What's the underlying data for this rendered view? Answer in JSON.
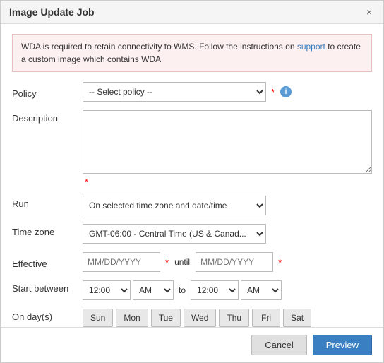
{
  "dialog": {
    "title": "Image Update Job",
    "close_label": "×"
  },
  "alert": {
    "message_part1": "WDA is required to retain connectivity to WMS. Follow the instructions on ",
    "link_text": "support",
    "message_part2": " to create a custom image which contains WDA"
  },
  "form": {
    "policy_label": "Policy",
    "policy_placeholder": "-- Select policy --",
    "description_label": "Description",
    "run_label": "Run",
    "run_placeholder": "On selected time zone and date/time",
    "timezone_label": "Time zone",
    "timezone_placeholder": "GMT-06:00 - Central Time (US & Canad...",
    "effective_label": "Effective",
    "effective_placeholder": "MM/DD/YYYY",
    "until_label": "until",
    "effective_placeholder2": "MM/DD/YYYY",
    "start_between_label": "Start between",
    "time1_value": "12:00",
    "ampm1_value": "AM",
    "to_label": "to",
    "time2_value": "12:00",
    "ampm2_value": "AM",
    "on_days_label": "On day(s)",
    "days": [
      "Sun",
      "Mon",
      "Tue",
      "Wed",
      "Thu",
      "Fri",
      "Sat"
    ]
  },
  "footer": {
    "cancel_label": "Cancel",
    "preview_label": "Preview"
  }
}
